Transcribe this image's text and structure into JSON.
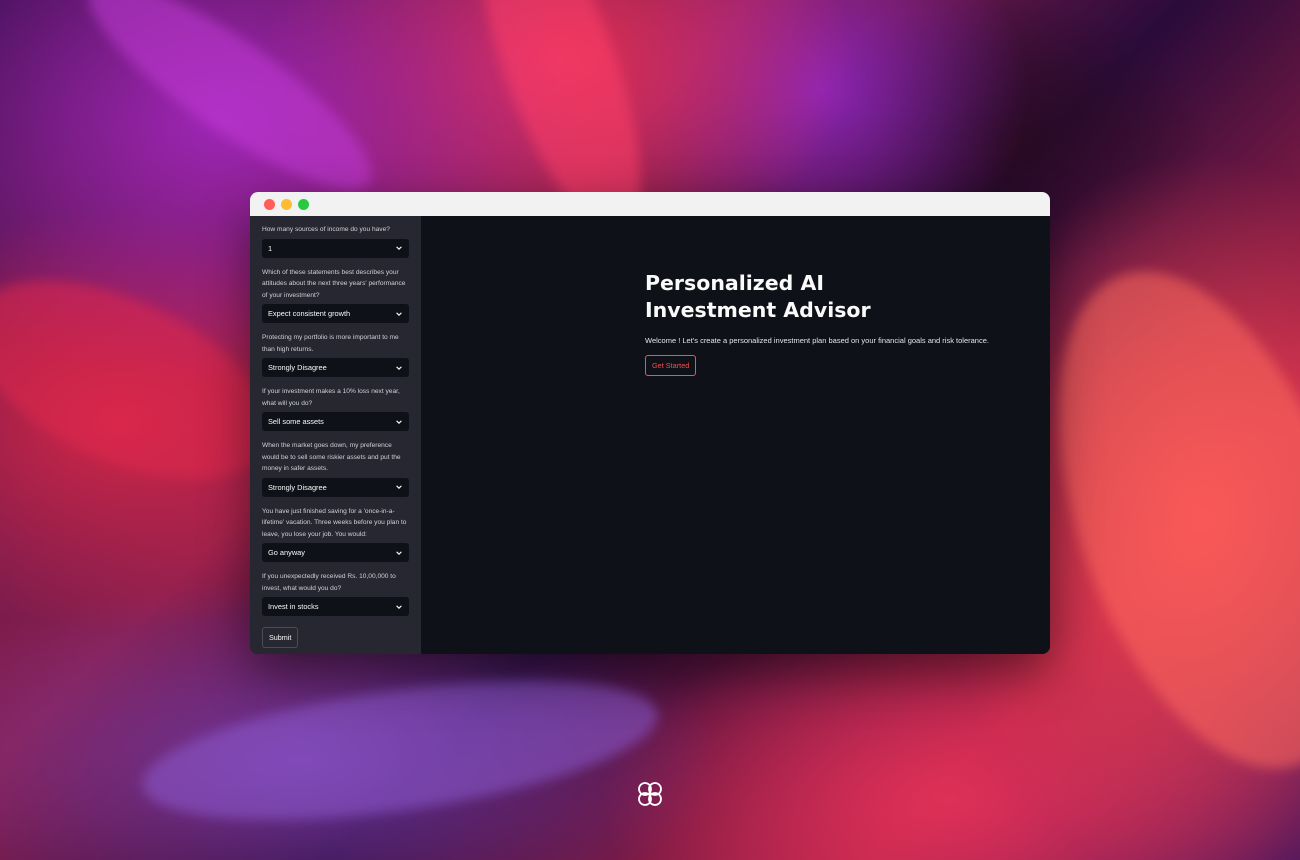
{
  "window": {
    "traffic_lights": [
      "#ff5f57",
      "#febc2e",
      "#28c840"
    ]
  },
  "sidebar": {
    "questions": [
      {
        "label": "How many sources of income do you have?",
        "value": "1"
      },
      {
        "label": "Which of these statements best describes your attitudes about the next three years' performance of your investment?",
        "value": "Expect consistent growth"
      },
      {
        "label": "Protecting my portfolio is more important to me than high returns.",
        "value": "Strongly Disagree"
      },
      {
        "label": "If your investment makes a 10% loss next year, what will you do?",
        "value": "Sell some assets"
      },
      {
        "label": "When the market goes down, my preference would be to sell some riskier assets and put the money in safer assets.",
        "value": "Strongly Disagree"
      },
      {
        "label": "You have just finished saving for a 'once-in-a-lifetime' vacation. Three weeks before you plan to leave, you lose your job. You would:",
        "value": "Go anyway"
      },
      {
        "label": "If you unexpectedly received Rs. 10,00,000 to invest, what would you do?",
        "value": "Invest in stocks"
      }
    ],
    "submit_label": "Submit"
  },
  "main": {
    "title": "Personalized AI Investment Advisor",
    "welcome": "Welcome ! Let's create a personalized investment plan based on your financial goals and risk tolerance.",
    "start_label": "Get Started"
  },
  "colors": {
    "accent": "#ff4b4b",
    "sidebar_bg": "#262730",
    "main_bg": "#0e1117"
  },
  "icons": {
    "dropdown": "chevron-down-icon",
    "brand": "logo-icon"
  }
}
